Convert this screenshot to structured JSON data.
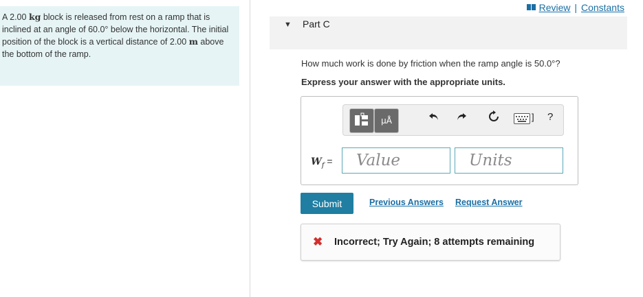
{
  "problem": {
    "text_before_kg": "A 2.00 ",
    "kg": "kg",
    "text_middle": " block is released from rest on a ramp that is inclined at an angle of 60.0° below the horizontal. The initial position of the block is a vertical distance of 2.00 ",
    "m": "m",
    "text_end": " above the bottom of the ramp."
  },
  "header": {
    "review": "Review",
    "separator": "|",
    "constants": "Constants"
  },
  "part": {
    "caret": "▼",
    "title": "Part C"
  },
  "question": "How much work is done by friction when the ramp angle is 50.0°?",
  "instruction": "Express your answer with the appropriate units.",
  "toolbar": {
    "units_button": "μÅ",
    "keyboard_bracket": "]",
    "help": "?"
  },
  "answer": {
    "variable": "W",
    "subscript": "f",
    "equals": "=",
    "value_placeholder": "Value",
    "units_placeholder": "Units"
  },
  "actions": {
    "submit": "Submit",
    "previous_answers": "Previous Answers",
    "request_answer": "Request Answer"
  },
  "feedback": {
    "icon": "✖",
    "text": "Incorrect; Try Again; 8 attempts remaining"
  },
  "colors": {
    "accent": "#1f7ea1",
    "link": "#1a6fa5",
    "error": "#d32f2f",
    "panel": "#e6f4f5"
  }
}
